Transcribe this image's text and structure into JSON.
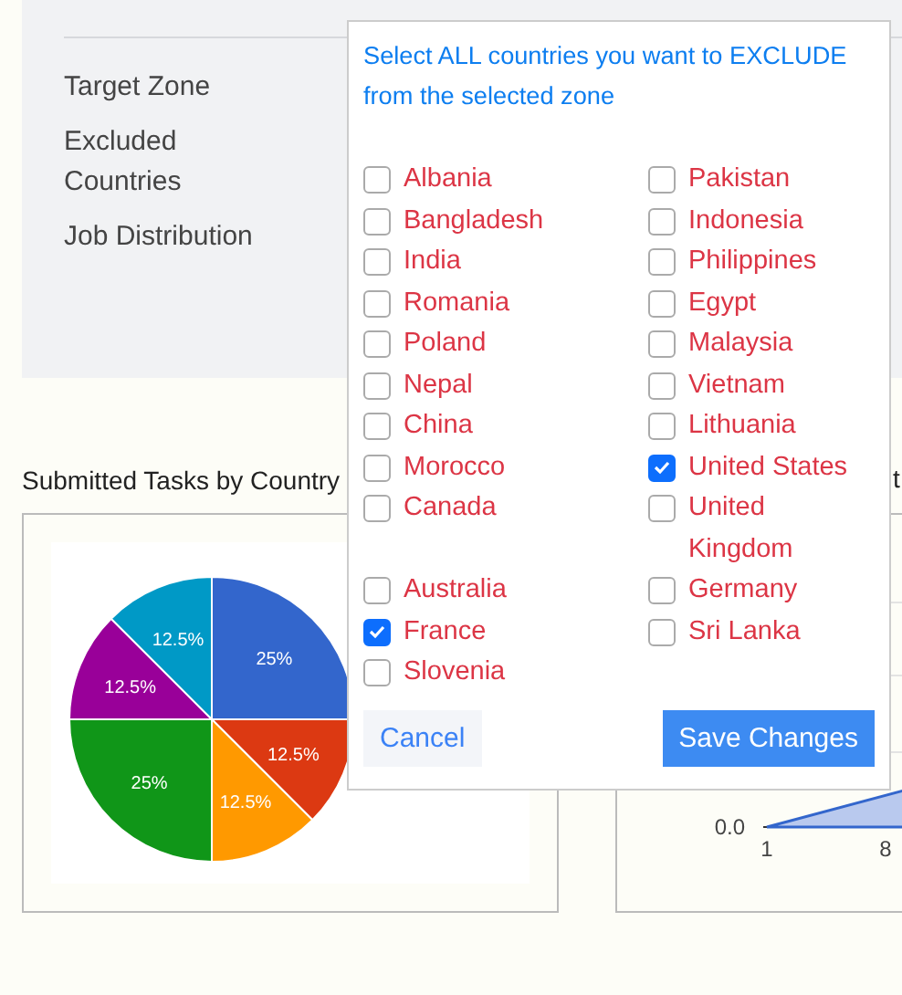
{
  "details": {
    "labels": [
      "Target Zone",
      "Excluded Countries",
      "Job Distribution"
    ]
  },
  "exclude_popover": {
    "heading": "Select ALL countries you want to EXCLUDE from the selected zone",
    "countries": [
      {
        "label": "Albania",
        "checked": false
      },
      {
        "label": "Pakistan",
        "checked": false
      },
      {
        "label": "Bangladesh",
        "checked": false
      },
      {
        "label": "Indonesia",
        "checked": false
      },
      {
        "label": "India",
        "checked": false
      },
      {
        "label": "Philippines",
        "checked": false
      },
      {
        "label": "Romania",
        "checked": false
      },
      {
        "label": "Egypt",
        "checked": false
      },
      {
        "label": "Poland",
        "checked": false
      },
      {
        "label": "Malaysia",
        "checked": false
      },
      {
        "label": "Nepal",
        "checked": false
      },
      {
        "label": "Vietnam",
        "checked": false
      },
      {
        "label": "China",
        "checked": false
      },
      {
        "label": "Lithuania",
        "checked": false
      },
      {
        "label": "Morocco",
        "checked": false
      },
      {
        "label": "United States",
        "checked": true
      },
      {
        "label": "Canada",
        "checked": false
      },
      {
        "label": "United Kingdom",
        "checked": false
      },
      {
        "label": "Australia",
        "checked": false
      },
      {
        "label": "Germany",
        "checked": false
      },
      {
        "label": "France",
        "checked": true
      },
      {
        "label": "Sri Lanka",
        "checked": false
      },
      {
        "label": "Slovenia",
        "checked": false
      }
    ],
    "buttons": {
      "cancel": "Cancel",
      "save": "Save Changes"
    }
  },
  "tasks_chart": {
    "title": "Submitted Tasks by Country",
    "chart_data": {
      "type": "pie",
      "values": [
        25,
        12.5,
        12.5,
        25,
        12.5,
        12.5
      ],
      "colors": [
        "#3366cc",
        "#dc3912",
        "#ff9900",
        "#109618",
        "#990099",
        "#0099c6"
      ],
      "data_labels": true,
      "value_labels": [
        "25%",
        "12.5%",
        "12.5%",
        "25%",
        "12.5%",
        "12.5%"
      ]
    }
  },
  "second_chart": {
    "title_fragment": "t",
    "y_tick": "0.0",
    "x_ticks": [
      "1",
      "8"
    ]
  }
}
